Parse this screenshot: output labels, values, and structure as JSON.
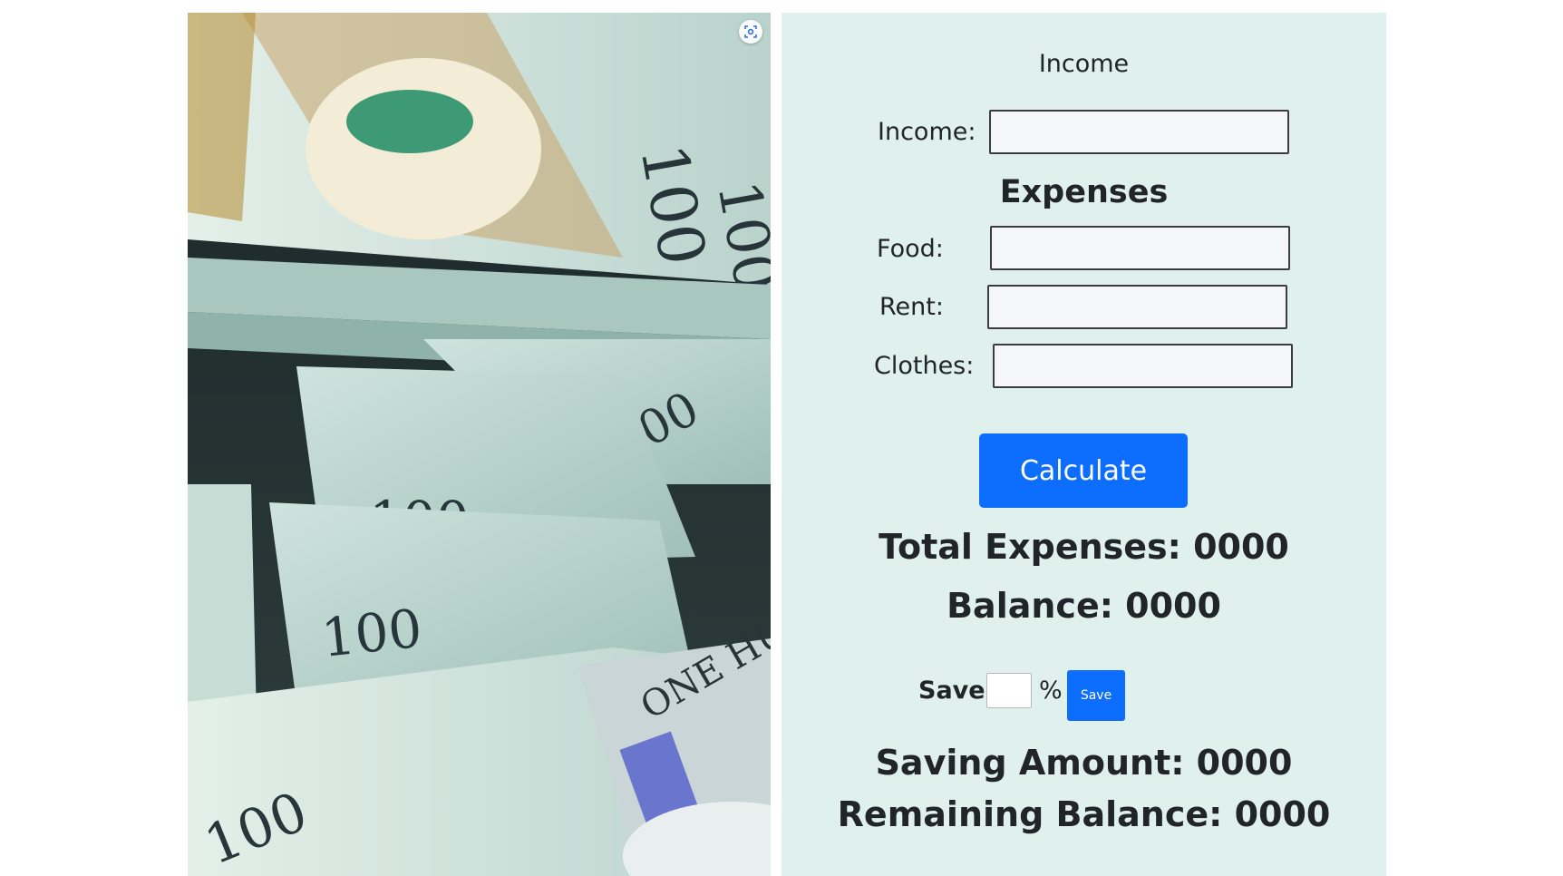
{
  "image": {
    "alt": "Stack of 100 dollar bills",
    "visual_search_icon": "visual-search-icon"
  },
  "form": {
    "income_heading": "Income",
    "income_label": "Income:",
    "income_value": "",
    "expenses_heading": "Expenses",
    "food_label": "Food:",
    "food_value": "",
    "rent_label": "Rent:",
    "rent_value": "",
    "clothes_label": "Clothes:",
    "clothes_value": "",
    "calculate_label": "Calculate",
    "total_expenses": "Total Expenses: 0000",
    "balance": "Balance: 0000",
    "save_label": "Save:",
    "save_percent_value": "",
    "percent_sign": "%",
    "save_button_label": "Save",
    "saving_amount": "Saving Amount: 0000",
    "remaining_balance": "Remaining Balance: 0000"
  },
  "colors": {
    "panel_bg": "#dff0ed",
    "primary_button": "#0d6efd",
    "text": "#212529"
  }
}
